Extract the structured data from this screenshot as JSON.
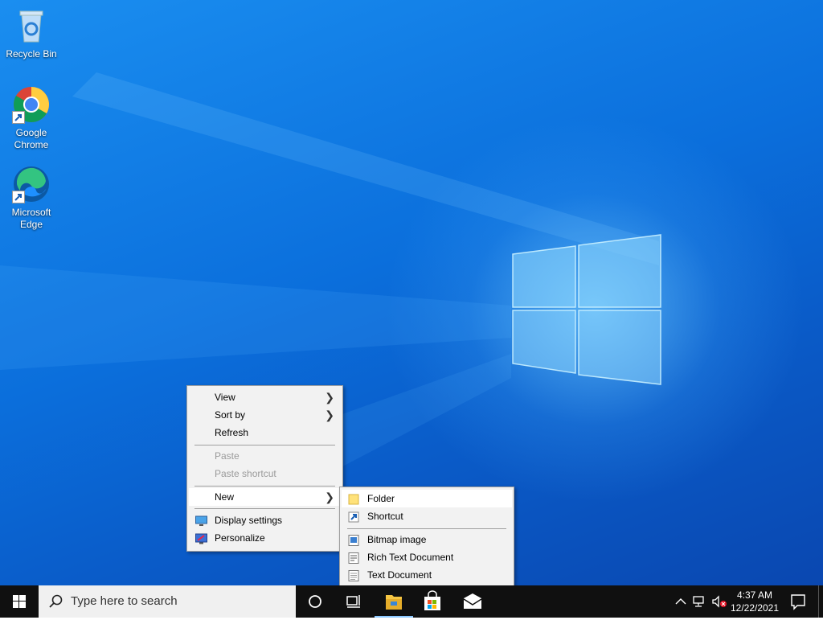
{
  "desktop": {
    "icons": [
      {
        "label": "Recycle Bin",
        "icon": "recycle-bin-icon"
      },
      {
        "label": "Google Chrome",
        "icon": "chrome-icon"
      },
      {
        "label": "Microsoft Edge",
        "icon": "edge-icon"
      }
    ]
  },
  "context_menu": {
    "items": [
      {
        "label": "View",
        "submenu": true
      },
      {
        "label": "Sort by",
        "submenu": true
      },
      {
        "label": "Refresh"
      },
      {
        "label": "Paste",
        "disabled": true
      },
      {
        "label": "Paste shortcut",
        "disabled": true
      },
      {
        "label": "New",
        "submenu": true,
        "highlighted": true
      },
      {
        "label": "Display settings",
        "icon": "display-settings-icon"
      },
      {
        "label": "Personalize",
        "icon": "personalize-icon"
      }
    ]
  },
  "new_submenu": {
    "items": [
      {
        "label": "Folder",
        "icon": "folder-icon",
        "highlighted": true
      },
      {
        "label": "Shortcut",
        "icon": "shortcut-icon"
      },
      {
        "label": "Bitmap image",
        "icon": "bitmap-icon"
      },
      {
        "label": "Rich Text Document",
        "icon": "rich-text-icon"
      },
      {
        "label": "Text Document",
        "icon": "text-document-icon"
      }
    ]
  },
  "taskbar": {
    "search_placeholder": "Type here to search",
    "pinned": [
      "cortana-icon",
      "task-view-icon",
      "file-explorer-icon",
      "microsoft-store-icon",
      "mail-icon"
    ],
    "time": "4:37 AM",
    "date": "12/22/2021"
  },
  "colors": {
    "accent": "#0a6fdc",
    "menu_bg": "#f2f2f2",
    "taskbar": "#101010"
  }
}
